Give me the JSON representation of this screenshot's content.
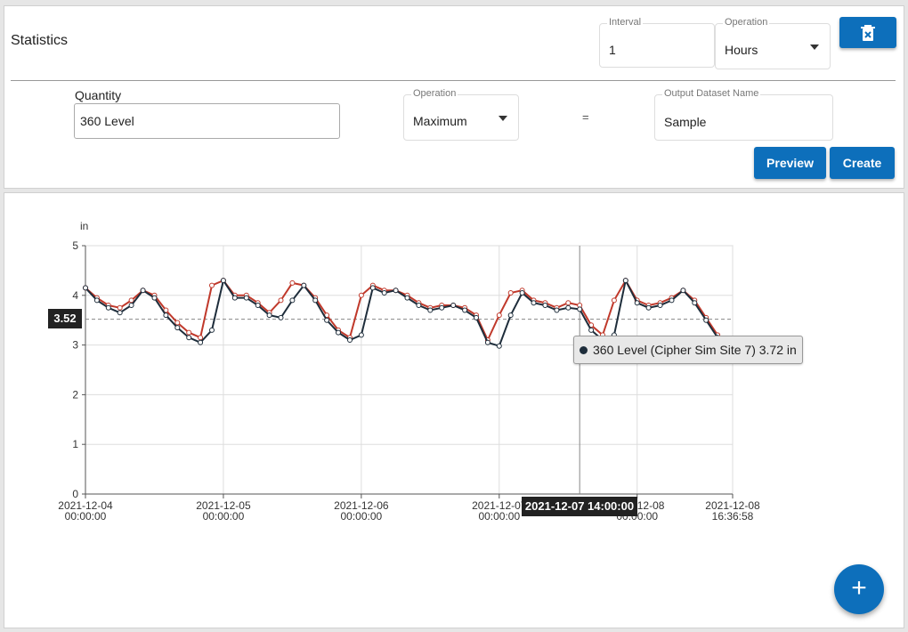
{
  "app": {
    "title": "Statistics"
  },
  "interval": {
    "label": "Interval",
    "value": "1"
  },
  "interval_unit": {
    "label": "Operation",
    "value": "Hours"
  },
  "quantity": {
    "label": "Quantity",
    "value": "360 Level"
  },
  "operation": {
    "label": "Operation",
    "value": "Maximum"
  },
  "equals": "=",
  "output": {
    "label": "Output Dataset Name",
    "value": "Sample"
  },
  "buttons": {
    "delete_icon": "delete-icon",
    "preview": "Preview",
    "create": "Create",
    "add": "+"
  },
  "colors": {
    "accent": "#0d6fbb",
    "series_dark": "#1e2d3b",
    "series_red": "#c0392b"
  },
  "chart_data": {
    "type": "line",
    "ylabel": "in",
    "ylim": [
      0,
      5
    ],
    "yticks": [
      "0",
      "1",
      "2",
      "3",
      "4",
      "5"
    ],
    "xlim": [
      "2021-12-04 00:00:00",
      "2021-12-08 16:36:58"
    ],
    "xticks": [
      {
        "date": "2021-12-04",
        "time": "00:00:00"
      },
      {
        "date": "2021-12-05",
        "time": "00:00:00"
      },
      {
        "date": "2021-12-06",
        "time": "00:00:00"
      },
      {
        "date": "2021-12-07",
        "time": "00:00:00"
      },
      {
        "date": "2021-12-08",
        "time": "00:00:00"
      },
      {
        "date": "2021-12-08",
        "time": "16:36:58"
      }
    ],
    "grid": true,
    "reference_line": 3.52,
    "crosshair": {
      "y_label": "3.52",
      "x_label": "2021-12-07 14:00:00"
    },
    "tooltip": {
      "text": "360 Level (Cipher Sim Site 7) 3.72 in"
    },
    "series": [
      {
        "name": "360 Level (Cipher Sim Site 7)",
        "color": "#1e2d3b",
        "x": [
          "2021-12-04 00:00",
          "2021-12-04 02:00",
          "2021-12-04 04:00",
          "2021-12-04 06:00",
          "2021-12-04 08:00",
          "2021-12-04 10:00",
          "2021-12-04 12:00",
          "2021-12-04 14:00",
          "2021-12-04 16:00",
          "2021-12-04 18:00",
          "2021-12-04 20:00",
          "2021-12-04 22:00",
          "2021-12-05 00:00",
          "2021-12-05 02:00",
          "2021-12-05 04:00",
          "2021-12-05 06:00",
          "2021-12-05 08:00",
          "2021-12-05 10:00",
          "2021-12-05 12:00",
          "2021-12-05 14:00",
          "2021-12-05 16:00",
          "2021-12-05 18:00",
          "2021-12-05 20:00",
          "2021-12-05 22:00",
          "2021-12-06 00:00",
          "2021-12-06 02:00",
          "2021-12-06 04:00",
          "2021-12-06 06:00",
          "2021-12-06 08:00",
          "2021-12-06 10:00",
          "2021-12-06 12:00",
          "2021-12-06 14:00",
          "2021-12-06 16:00",
          "2021-12-06 18:00",
          "2021-12-06 20:00",
          "2021-12-06 22:00",
          "2021-12-07 00:00",
          "2021-12-07 02:00",
          "2021-12-07 04:00",
          "2021-12-07 06:00",
          "2021-12-07 08:00",
          "2021-12-07 10:00",
          "2021-12-07 12:00",
          "2021-12-07 14:00",
          "2021-12-07 16:00",
          "2021-12-07 18:00",
          "2021-12-07 20:00",
          "2021-12-07 22:00",
          "2021-12-08 00:00",
          "2021-12-08 02:00",
          "2021-12-08 04:00",
          "2021-12-08 06:00",
          "2021-12-08 08:00",
          "2021-12-08 10:00",
          "2021-12-08 12:00",
          "2021-12-08 14:00",
          "2021-12-08 16:00"
        ],
        "y": [
          4.15,
          3.9,
          3.75,
          3.65,
          3.8,
          4.1,
          3.95,
          3.6,
          3.35,
          3.15,
          3.05,
          3.3,
          4.3,
          3.95,
          3.95,
          3.8,
          3.6,
          3.55,
          3.9,
          4.2,
          3.9,
          3.5,
          3.25,
          3.1,
          3.2,
          4.15,
          4.05,
          4.1,
          3.95,
          3.8,
          3.7,
          3.75,
          3.8,
          3.7,
          3.55,
          3.05,
          2.98,
          3.6,
          4.05,
          3.85,
          3.8,
          3.7,
          3.75,
          3.72,
          3.3,
          3.1,
          3.2,
          4.3,
          3.85,
          3.75,
          3.8,
          3.9,
          4.1,
          3.85,
          3.5,
          3.15,
          2.95
        ]
      },
      {
        "name": "Sample",
        "color": "#c0392b",
        "x": [
          "2021-12-04 00:00",
          "2021-12-04 02:00",
          "2021-12-04 04:00",
          "2021-12-04 06:00",
          "2021-12-04 08:00",
          "2021-12-04 10:00",
          "2021-12-04 12:00",
          "2021-12-04 14:00",
          "2021-12-04 16:00",
          "2021-12-04 18:00",
          "2021-12-04 20:00",
          "2021-12-04 22:00",
          "2021-12-05 00:00",
          "2021-12-05 02:00",
          "2021-12-05 04:00",
          "2021-12-05 06:00",
          "2021-12-05 08:00",
          "2021-12-05 10:00",
          "2021-12-05 12:00",
          "2021-12-05 14:00",
          "2021-12-05 16:00",
          "2021-12-05 18:00",
          "2021-12-05 20:00",
          "2021-12-05 22:00",
          "2021-12-06 00:00",
          "2021-12-06 02:00",
          "2021-12-06 04:00",
          "2021-12-06 06:00",
          "2021-12-06 08:00",
          "2021-12-06 10:00",
          "2021-12-06 12:00",
          "2021-12-06 14:00",
          "2021-12-06 16:00",
          "2021-12-06 18:00",
          "2021-12-06 20:00",
          "2021-12-06 22:00",
          "2021-12-07 00:00",
          "2021-12-07 02:00",
          "2021-12-07 04:00",
          "2021-12-07 06:00",
          "2021-12-07 08:00",
          "2021-12-07 10:00",
          "2021-12-07 12:00",
          "2021-12-07 14:00",
          "2021-12-07 16:00",
          "2021-12-07 18:00",
          "2021-12-07 20:00",
          "2021-12-07 22:00",
          "2021-12-08 00:00",
          "2021-12-08 02:00",
          "2021-12-08 04:00",
          "2021-12-08 06:00",
          "2021-12-08 08:00",
          "2021-12-08 10:00",
          "2021-12-08 12:00",
          "2021-12-08 14:00",
          "2021-12-08 16:00"
        ],
        "y": [
          4.15,
          3.95,
          3.8,
          3.75,
          3.9,
          4.1,
          4.0,
          3.7,
          3.45,
          3.25,
          3.15,
          4.2,
          4.3,
          4.0,
          4.0,
          3.85,
          3.65,
          3.9,
          4.25,
          4.2,
          3.95,
          3.6,
          3.3,
          3.15,
          4.0,
          4.2,
          4.1,
          4.1,
          4.0,
          3.85,
          3.75,
          3.8,
          3.8,
          3.75,
          3.6,
          3.1,
          3.6,
          4.05,
          4.1,
          3.9,
          3.85,
          3.75,
          3.85,
          3.8,
          3.4,
          3.2,
          3.9,
          4.3,
          3.9,
          3.8,
          3.85,
          3.95,
          4.1,
          3.9,
          3.55,
          3.2,
          3.0
        ]
      }
    ]
  }
}
